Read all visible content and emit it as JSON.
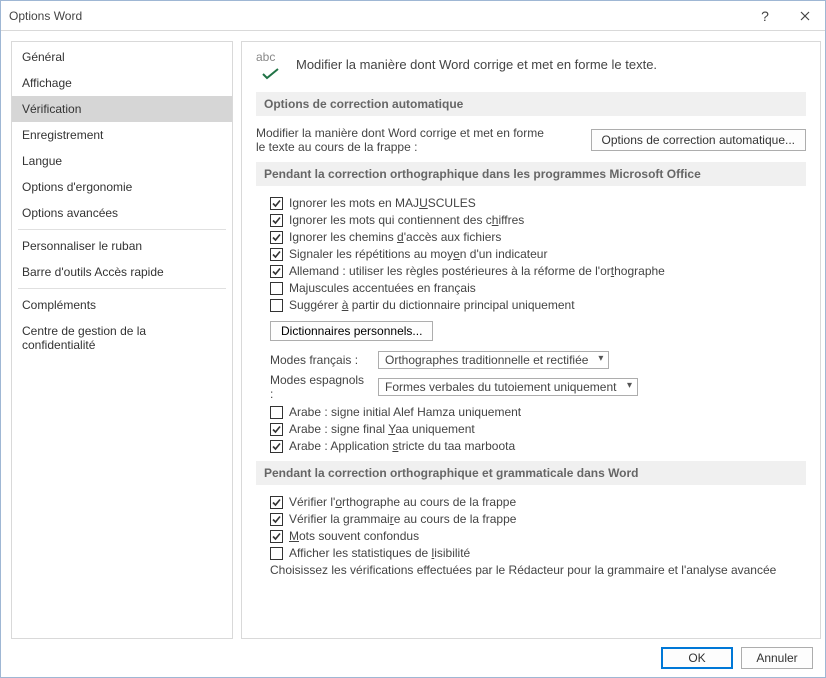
{
  "title": "Options Word",
  "sidebar": {
    "items": [
      {
        "label": "Général"
      },
      {
        "label": "Affichage"
      },
      {
        "label": "Vérification"
      },
      {
        "label": "Enregistrement"
      },
      {
        "label": "Langue"
      },
      {
        "label": "Options d'ergonomie"
      },
      {
        "label": "Options avancées"
      },
      {
        "label": "Personnaliser le ruban"
      },
      {
        "label": "Barre d'outils Accès rapide"
      },
      {
        "label": "Compléments"
      },
      {
        "label": "Centre de gestion de la confidentialité"
      }
    ],
    "selected_index": 2,
    "separators_after": [
      6,
      8
    ]
  },
  "header": {
    "icon_text": "abc",
    "text": "Modifier la manière dont Word corrige et met en forme le texte."
  },
  "section_autocorrect": {
    "title": "Options de correction automatique",
    "desc": "Modifier la manière dont Word corrige et met en forme le texte au cours de la frappe :",
    "button": "Options de correction automatique..."
  },
  "section_spelling": {
    "title": "Pendant la correction orthographique dans les programmes Microsoft Office",
    "checks": [
      {
        "checked": true,
        "label_pre": "Ignorer les mots en MAJ",
        "label_u": "U",
        "label_post": "SCULES"
      },
      {
        "checked": true,
        "label_pre": "Ignorer les mots qui contiennent des c",
        "label_u": "h",
        "label_post": "iffres"
      },
      {
        "checked": true,
        "label_pre": "Ignorer les chemins ",
        "label_u": "d",
        "label_post": "'accès aux fichiers"
      },
      {
        "checked": true,
        "label_pre": "Signaler les répétitions au moy",
        "label_u": "e",
        "label_post": "n d'un indicateur"
      },
      {
        "checked": true,
        "label_pre": "Allemand : utiliser les règles postérieures à la réforme de l'or",
        "label_u": "t",
        "label_post": "hographe"
      },
      {
        "checked": false,
        "label_pre": "Majuscules accentuées en français",
        "label_u": "",
        "label_post": ""
      },
      {
        "checked": false,
        "label_pre": "Suggérer ",
        "label_u": "à",
        "label_post": " partir du dictionnaire principal uniquement"
      }
    ],
    "dict_button": "Dictionnaires personnels...",
    "mode_fr_label": "Modes français :",
    "mode_fr_value": "Orthographes traditionnelle et rectifiée",
    "mode_es_label": "Modes espagnols :",
    "mode_es_value": "Formes verbales du tutoiement uniquement",
    "arabic_checks": [
      {
        "checked": false,
        "label_pre": "Arabe : signe initial Alef Hamza uniquement",
        "label_u": "",
        "label_post": ""
      },
      {
        "checked": true,
        "label_pre": "Arabe : signe final ",
        "label_u": "Y",
        "label_post": "aa uniquement"
      },
      {
        "checked": true,
        "label_pre": "Arabe : Application ",
        "label_u": "s",
        "label_post": "tricte du taa marboota"
      }
    ]
  },
  "section_word": {
    "title": "Pendant la correction orthographique et grammaticale dans Word",
    "checks": [
      {
        "checked": true,
        "label_pre": "Vérifier l'",
        "label_u": "o",
        "label_post": "rthographe au cours de la frappe"
      },
      {
        "checked": true,
        "label_pre": "Vérifier la grammai",
        "label_u": "r",
        "label_post": "e au cours de la frappe"
      },
      {
        "checked": true,
        "label_pre": "",
        "label_u": "M",
        "label_post": "ots souvent confondus"
      },
      {
        "checked": false,
        "label_pre": "Afficher les statistiques de ",
        "label_u": "l",
        "label_post": "isibilité"
      }
    ],
    "truncated_text": "Choisissez les vérifications effectuées par le Rédacteur pour la grammaire et l'analyse avancée"
  },
  "footer": {
    "ok": "OK",
    "cancel": "Annuler"
  }
}
